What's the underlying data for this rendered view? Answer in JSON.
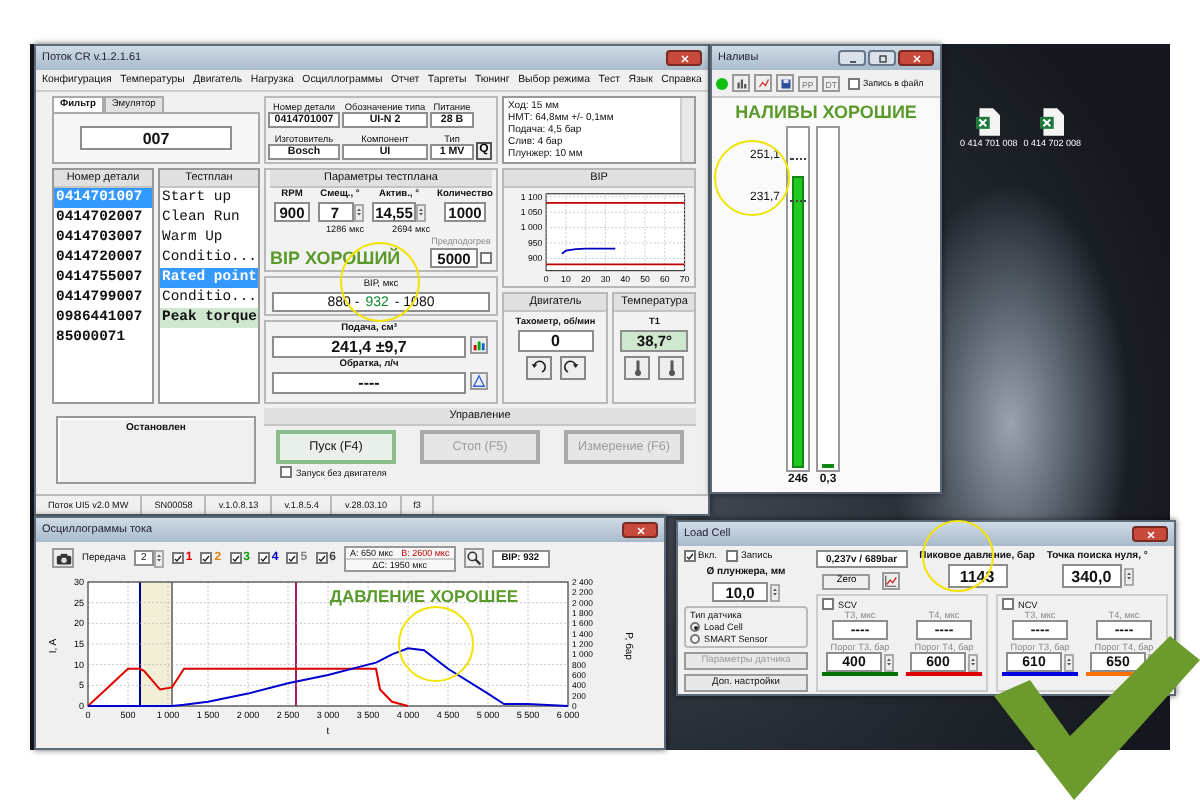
{
  "main_window": {
    "title": "Поток CR v.1.2.1.61",
    "menu": [
      "Конфигурация",
      "Температуры",
      "Двигатель",
      "Нагрузка",
      "Осциллограммы",
      "Отчет",
      "Таргеты",
      "Тюнинг",
      "Выбор режима",
      "Тест",
      "Язык",
      "Справка"
    ],
    "filter_tabs": [
      {
        "label": "Фильтр",
        "selected": true
      },
      {
        "label": "Эмулятор",
        "selected": false
      }
    ],
    "filter_value": "007",
    "part_info": [
      {
        "label": "Номер детали",
        "value": "0414701007"
      },
      {
        "label": "Обозначение типа",
        "value": "UI-N 2"
      },
      {
        "label": "Питание",
        "value": "28 В"
      },
      {
        "label": "Изготовитель",
        "value": "Bosch"
      },
      {
        "label": "Компонент",
        "value": "UI"
      },
      {
        "label": "Тип",
        "value": "1 MV"
      }
    ],
    "info_button": "Q",
    "notes": [
      "Ход: 15 мм",
      "НМТ: 64,8мм +/- 0,1мм",
      "Подача: 4,5 бар",
      "Слив: 4 бар",
      "Плунжер: 10 мм"
    ],
    "parts": {
      "header": "Номер детали",
      "items": [
        {
          "label": "0414701007",
          "selected": true
        },
        {
          "label": "0414702007",
          "selected": false
        },
        {
          "label": "0414703007",
          "selected": false
        },
        {
          "label": "0414720007",
          "selected": false
        },
        {
          "label": "0414755007",
          "selected": false
        },
        {
          "label": "0414799007",
          "selected": false
        },
        {
          "label": "0986441007",
          "selected": false
        },
        {
          "label": "85000071",
          "selected": false
        }
      ]
    },
    "testplan": {
      "header": "Тестплан",
      "items": [
        {
          "label": "Start up",
          "selected": false,
          "current": false
        },
        {
          "label": "Clean Run",
          "selected": false,
          "current": false
        },
        {
          "label": "Warm Up",
          "selected": false,
          "current": false
        },
        {
          "label": "Conditio...",
          "selected": false,
          "current": false
        },
        {
          "label": "Rated point",
          "selected": true,
          "current": false
        },
        {
          "label": "Conditio...",
          "selected": false,
          "current": false
        },
        {
          "label": "Peak torque",
          "selected": false,
          "current": true
        }
      ]
    },
    "params": {
      "title": "Параметры тестплана",
      "fields": [
        {
          "label": "RPM",
          "value": "900",
          "spinner": false
        },
        {
          "label": "Смещ., °",
          "value": "7",
          "spinner": true
        },
        {
          "label": "Актив., °",
          "value": "14,55",
          "spinner": true
        },
        {
          "label": "Количество",
          "value": "1000",
          "spinner": false
        }
      ],
      "durations": [
        "1286 мкс",
        "2694 мкс"
      ],
      "verdict": "ВІР ХОРОШИЙ",
      "preheat": {
        "label": "Предподогрев",
        "value": "5000",
        "checked": false
      }
    },
    "bip": {
      "label": "ВІР, мкс",
      "low": "880 -",
      "value": "932",
      "high": "- 1080"
    },
    "bip_chart": {
      "title": "ВІР",
      "chart_data": {
        "type": "line",
        "x": [
          0,
          8,
          10,
          15,
          20,
          25,
          30,
          35,
          40,
          50,
          60,
          70
        ],
        "series": [
          {
            "color": "#c00000",
            "values": [
              1080,
              1080,
              1080,
              1080,
              1080,
              1080,
              1080,
              1080,
              1080,
              1080,
              1080,
              1080
            ]
          },
          {
            "color": "#c00000",
            "values": [
              880,
              880,
              880,
              880,
              880,
              880,
              880,
              880,
              880,
              880,
              880,
              880
            ]
          },
          {
            "color": "#0000c0",
            "values": [
              null,
              915,
              925,
              930,
              931,
              932,
              932,
              932,
              null,
              null,
              null,
              null
            ]
          }
        ],
        "xlim": [
          0,
          70
        ],
        "ylim": [
          860,
          1110
        ],
        "grid": true,
        "xticks": [
          0,
          10,
          20,
          30,
          40,
          50,
          60,
          70
        ],
        "yticks": [
          {
            "value": 900,
            "label": "900"
          },
          {
            "value": 950,
            "label": "950"
          },
          {
            "value": 1000,
            "label": "1 000"
          },
          {
            "value": 1050,
            "label": "1 050"
          },
          {
            "value": 1100,
            "label": "1 100"
          }
        ]
      }
    },
    "engine": {
      "title": "Двигатель",
      "tacho_label": "Тахометр, об/мин",
      "tacho_value": "0"
    },
    "temperature": {
      "title": "Температура",
      "sensor": "T1",
      "value": "38,7°"
    },
    "supply": {
      "label": "Подача, см³",
      "value": "241,4 ±9,7"
    },
    "return_flow": {
      "label": "Обратка, л/ч",
      "value": "----"
    },
    "state_text": "Остановлен",
    "control": {
      "title": "Управление",
      "buttons": [
        {
          "label": "Пуск (F4)",
          "disabled": false
        },
        {
          "label": "Стоп (F5)",
          "disabled": true
        },
        {
          "label": "Измерение (F6)",
          "disabled": true
        }
      ],
      "no_engine": {
        "label": "Запуск без двигателя",
        "checked": false
      }
    },
    "status_bar": [
      "Поток UI5 v2.0 MW",
      "SN00058",
      "v.1.0.8.13",
      "v.1.8.5.4",
      "v.28.03.10",
      "f3"
    ]
  },
  "fills_window": {
    "title": "Наливы",
    "running": true,
    "toolbar": [
      "PP",
      "DT"
    ],
    "record": {
      "label": "Запись в файл",
      "checked": false
    },
    "verdict": "НАЛИВЫ ХОРОШИЕ",
    "upper_limit": "251,1",
    "lower_limit": "231,7",
    "bars": [
      {
        "level": 0.86,
        "reading": "246"
      },
      {
        "level": 0,
        "reading": "0,3"
      }
    ]
  },
  "desktop_icons": [
    {
      "label": "0 414 701 008"
    },
    {
      "label": "0 414 702 008"
    }
  ],
  "oscillogram": {
    "title": "Осциллограммы тока",
    "transfer": {
      "label": "Передача",
      "value": "2"
    },
    "channels": [
      {
        "label": "1",
        "checked": true,
        "color": "#e00000"
      },
      {
        "label": "2",
        "checked": true,
        "color": "#e08000"
      },
      {
        "label": "3",
        "checked": true,
        "color": "#00a000"
      },
      {
        "label": "4",
        "checked": true,
        "color": "#0000d0"
      },
      {
        "label": "5",
        "checked": true,
        "color": "#808080"
      },
      {
        "label": "6",
        "checked": true,
        "color": "#404040"
      }
    ],
    "cursor_a": "A: 650 мкс",
    "cursor_b": "B: 2600 мкс",
    "delta": "ΔC: 1950 мкс",
    "bip": "ВІР: 932",
    "verdict": "ДАВЛЕНИЕ ХОРОШЕЕ",
    "pressure_axis": {
      "label": "P, бар",
      "ticks": [
        "2 400",
        "2 200",
        "2 000",
        "1 800",
        "1 600",
        "1 400",
        "1 200",
        "1 000",
        "800",
        "600",
        "400",
        "200",
        "0"
      ]
    },
    "chart_data": {
      "type": "line",
      "xlabel": "t",
      "ylabel": "I, A",
      "x": [
        0,
        500,
        650,
        700,
        900,
        1050,
        1200,
        1500,
        2000,
        2500,
        3000,
        3500,
        3600,
        3650,
        3800,
        4000,
        4200,
        4500,
        5000,
        5200,
        5500,
        6000
      ],
      "series": [
        {
          "color": "#e00000",
          "values": [
            0,
            9,
            9,
            8.5,
            4,
            4.5,
            9,
            9,
            9,
            9,
            9,
            9,
            9,
            4,
            1,
            0,
            null,
            null,
            null,
            null,
            null,
            null
          ]
        },
        {
          "color": "#0000d0",
          "values": [
            0,
            0,
            0,
            0,
            0,
            0,
            0.3,
            1,
            3,
            5.5,
            7.5,
            10,
            10.5,
            11,
            12.5,
            14,
            13.5,
            9,
            3,
            0.5,
            0.5,
            0
          ]
        }
      ],
      "xlim": [
        0,
        6000
      ],
      "ylim": [
        0,
        30
      ],
      "grid": true,
      "xticks": [
        {
          "value": 0,
          "label": "0"
        },
        {
          "value": 500,
          "label": "500"
        },
        {
          "value": 1000,
          "label": "1 000"
        },
        {
          "value": 1500,
          "label": "1 500"
        },
        {
          "value": 2000,
          "label": "2 000"
        },
        {
          "value": 2500,
          "label": "2 500"
        },
        {
          "value": 3000,
          "label": "3 000"
        },
        {
          "value": 3500,
          "label": "3 500"
        },
        {
          "value": 4000,
          "label": "4 000"
        },
        {
          "value": 4500,
          "label": "4 500"
        },
        {
          "value": 5000,
          "label": "5 000"
        },
        {
          "value": 5500,
          "label": "5 500"
        },
        {
          "value": 6000,
          "label": "6 000"
        }
      ],
      "yticks": [
        0,
        5,
        10,
        15,
        20,
        25,
        30
      ],
      "bands": [
        {
          "axis": "x",
          "from": 650,
          "to": 1050,
          "color": "#f2efd6"
        }
      ],
      "ref_lines": [
        {
          "axis": "x",
          "value": 650,
          "color": "#000090"
        },
        {
          "axis": "x",
          "value": 1050,
          "color": "#808080"
        },
        {
          "axis": "x",
          "value": 2600,
          "color": "#a0205a"
        }
      ]
    }
  },
  "load_cell": {
    "title": "Load Cell",
    "enabled": {
      "label": "Вкл.",
      "checked": true
    },
    "record": {
      "label": "Запись",
      "checked": false
    },
    "plunger": {
      "label": "Ø плунжера, мм",
      "value": "10,0"
    },
    "sensor_type": {
      "title": "Тип датчика",
      "options": [
        {
          "label": "Load Cell",
          "selected": true
        },
        {
          "label": "SMART Sensor",
          "selected": false
        }
      ]
    },
    "buttons": [
      {
        "label": "Параметры датчика",
        "disabled": true
      },
      {
        "label": "Доп. настройки",
        "disabled": false
      }
    ],
    "reading": "0,237v / 689bar",
    "zero_button": "Zero",
    "peak": {
      "label": "Пиковое давление, бар",
      "value": "1143"
    },
    "zero_point": {
      "label": "Точка поиска нуля, °",
      "value": "340,0"
    },
    "groups": [
      {
        "title": "SCV",
        "checked": false,
        "times": [
          {
            "label": "T3, мкс",
            "value": "----"
          },
          {
            "label": "T4, мкс",
            "value": "----"
          }
        ],
        "thresholds": [
          {
            "label": "Порог Т3, бар",
            "value": "400",
            "color": "#007000"
          },
          {
            "label": "Порог Т4, бар",
            "value": "600",
            "color": "#e00000"
          }
        ]
      },
      {
        "title": "NCV",
        "checked": false,
        "times": [
          {
            "label": "T3, мкс",
            "value": "----"
          },
          {
            "label": "T4, мкс",
            "value": "----"
          }
        ],
        "thresholds": [
          {
            "label": "Порог Т3, бар",
            "value": "610",
            "color": "#0000e0"
          },
          {
            "label": "Порог Т4, бар",
            "value": "650",
            "color": "#ff7000"
          }
        ]
      }
    ]
  }
}
